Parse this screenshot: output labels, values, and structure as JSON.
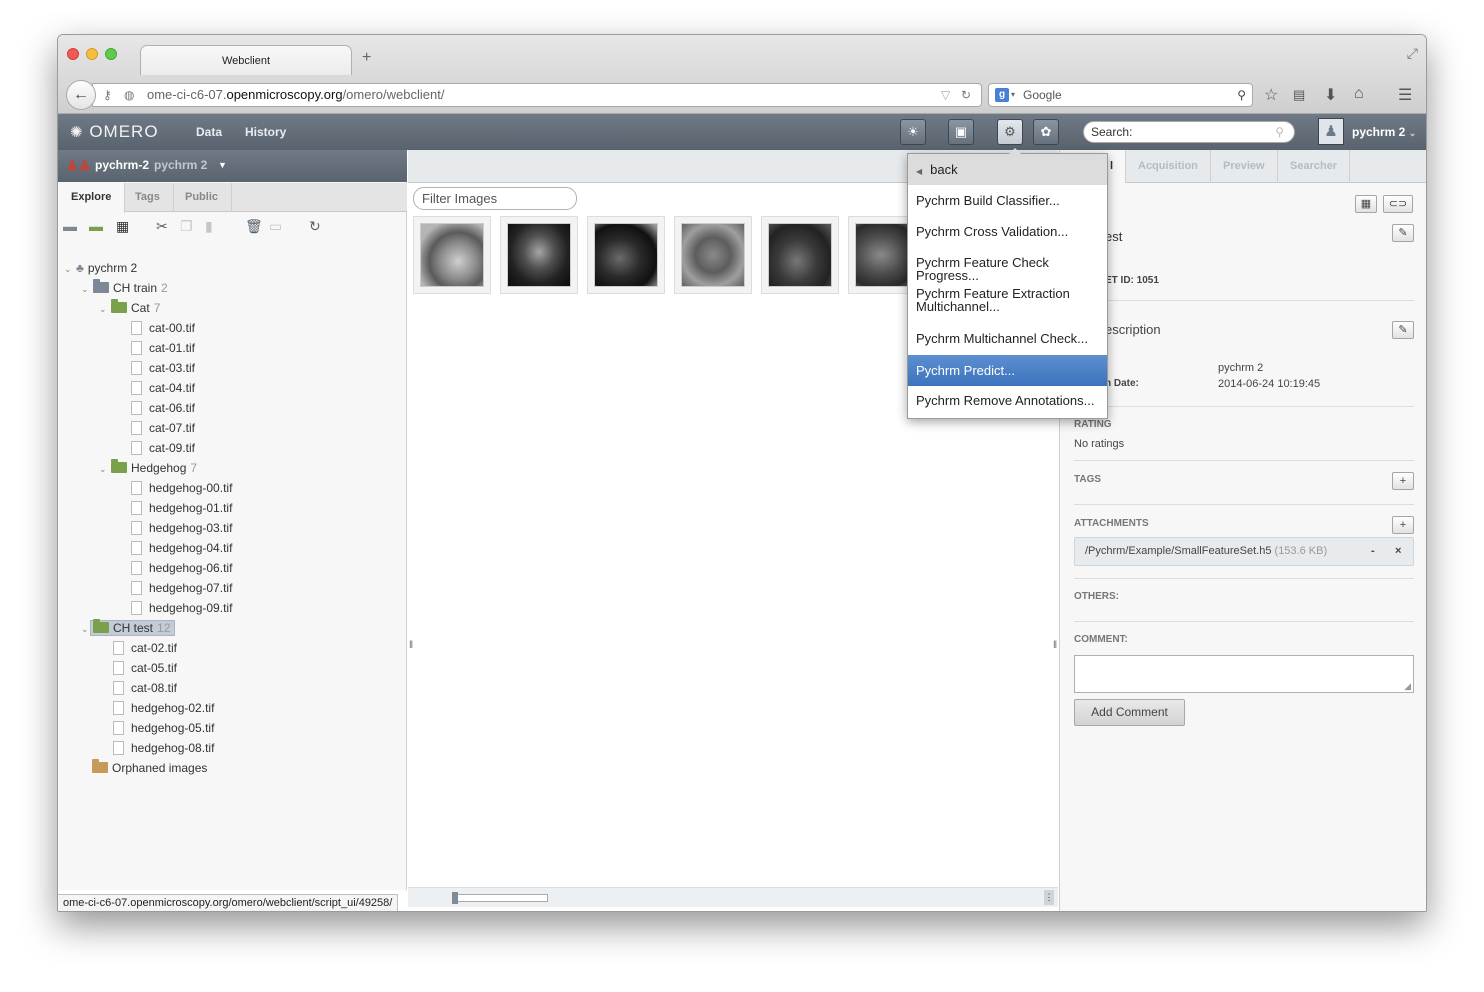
{
  "browser": {
    "tab_title": "Webclient",
    "url_prefix": "ome-ci-c6-07.",
    "url_domain": "openmicroscopy.org",
    "url_path": "/omero/webclient/",
    "search_placeholder": "Google"
  },
  "nav": {
    "logo": "OMERO",
    "links": [
      "Data",
      "History"
    ],
    "search_label": "Search:",
    "user": "pychrm 2"
  },
  "left": {
    "group_name": "pychrm-2",
    "group_user": "pychrm 2",
    "tabs": [
      "Explore",
      "Tags",
      "Public"
    ],
    "tree": {
      "root": "pychrm 2",
      "project": {
        "name": "CH train",
        "count": "2"
      },
      "datasets": [
        {
          "name": "Cat",
          "count": "7",
          "images": [
            "cat-00.tif",
            "cat-01.tif",
            "cat-03.tif",
            "cat-04.tif",
            "cat-06.tif",
            "cat-07.tif",
            "cat-09.tif"
          ]
        },
        {
          "name": "Hedgehog",
          "count": "7",
          "images": [
            "hedgehog-00.tif",
            "hedgehog-01.tif",
            "hedgehog-03.tif",
            "hedgehog-04.tif",
            "hedgehog-06.tif",
            "hedgehog-07.tif",
            "hedgehog-09.tif"
          ]
        }
      ],
      "test": {
        "name": "CH test",
        "count": "12",
        "images": [
          "cat-02.tif",
          "cat-05.tif",
          "cat-08.tif",
          "hedgehog-02.tif",
          "hedgehog-05.tif",
          "hedgehog-08.tif"
        ]
      },
      "orphaned": "Orphaned images"
    }
  },
  "center": {
    "filter_placeholder": "Filter Images"
  },
  "menu": {
    "back": "back",
    "items": [
      "Pychrm Build Classifier...",
      "Pychrm Cross Validation...",
      "Pychrm Feature Check Progress...",
      "Pychrm Feature Extraction Multichannel...",
      "Pychrm Multichannel Check...",
      "Pychrm Predict...",
      "Pychrm Remove Annotations..."
    ],
    "selected_index": 5
  },
  "right": {
    "tabs": [
      "l",
      "Acquisition",
      "Preview",
      "Searcher"
    ],
    "name": "est",
    "id_label": "ET ID:",
    "id_value": "1051",
    "description": "escription",
    "owner_value": "pychrm 2",
    "date_label": "n Date:",
    "date_value": "2014-06-24 10:19:45",
    "rating_label": "RATING",
    "rating_value": "No ratings",
    "tags_label": "TAGS",
    "attachments_label": "ATTACHMENTS",
    "attachment_name": "/Pychrm/Example/SmallFeatureSet.h5",
    "attachment_size": "(153.6 KB)",
    "others_label": "OTHERS:",
    "comment_label": "COMMENT:",
    "add_comment": "Add Comment"
  },
  "status": {
    "url": "ome-ci-c6-07.openmicroscopy.org/omero/webclient/script_ui/49258/"
  },
  "colors": {
    "nav": "#626d78",
    "selected": "#4a80c8",
    "dataset_folder": "#7ba04c",
    "project_folder": "#7c8896"
  }
}
